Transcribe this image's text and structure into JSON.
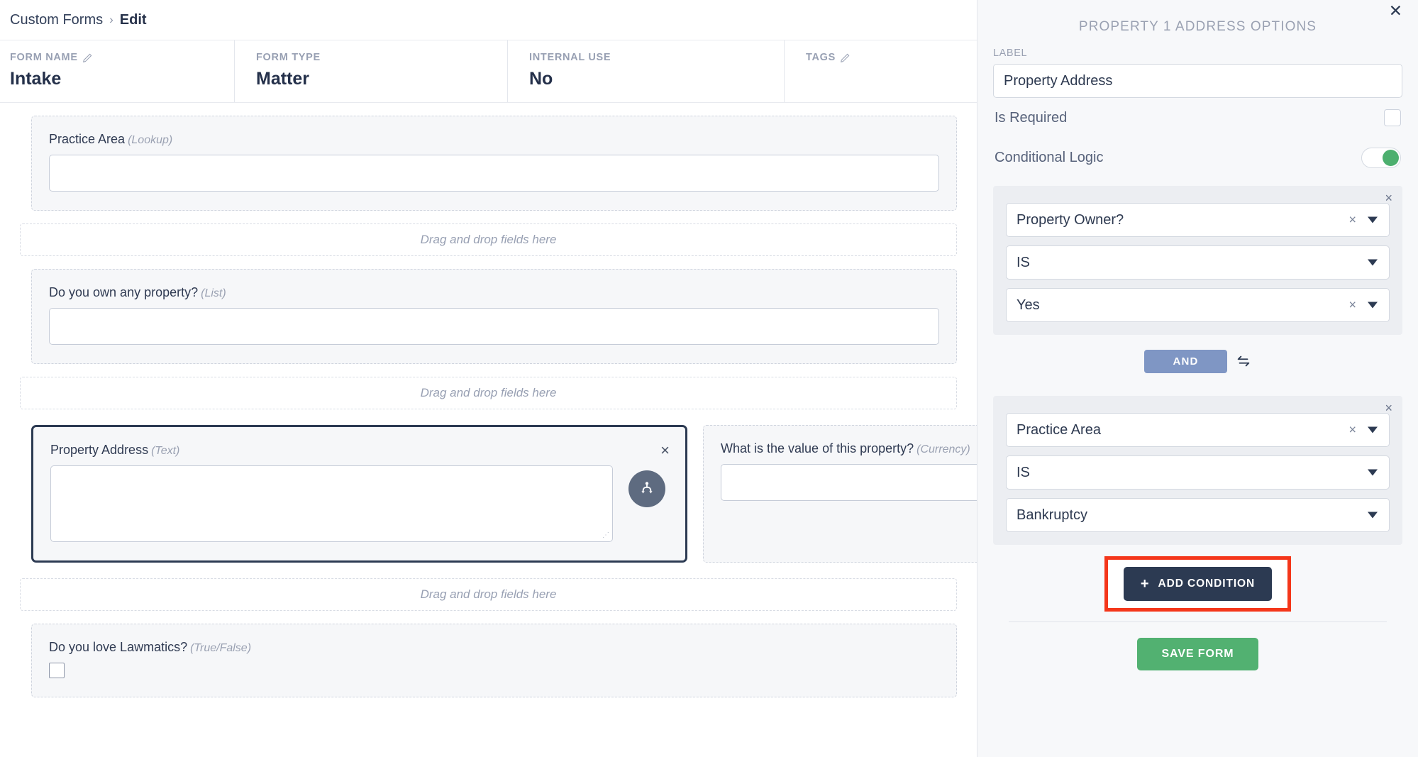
{
  "breadcrumb": {
    "root": "Custom Forms",
    "separator": "›",
    "current": "Edit"
  },
  "meta": [
    {
      "label": "FORM NAME",
      "value": "Intake",
      "has_edit_icon": true,
      "edit_icon": "pencil-icon"
    },
    {
      "label": "FORM TYPE",
      "value": "Matter",
      "has_edit_icon": false
    },
    {
      "label": "INTERNAL USE",
      "value": "No",
      "has_edit_icon": false
    },
    {
      "label": "TAGS",
      "value": "",
      "has_edit_icon": true,
      "edit_icon": "pencil-icon"
    }
  ],
  "canvas": {
    "dropzone_text": "Drag and drop fields here",
    "fields": [
      {
        "label": "Practice Area",
        "type": "(Lookup)",
        "control": "input"
      },
      {
        "label": "Do you own any property?",
        "type": "(List)",
        "control": "input"
      },
      {
        "label": "Property Address",
        "type": "(Text)",
        "control": "textarea",
        "selected": true,
        "remove_label": "×",
        "badge_icon": "conditional-logic-branch-icon"
      },
      {
        "label": "What is the value of this property?",
        "type": "(Currency)",
        "control": "input"
      },
      {
        "label": "Do you love Lawmatics?",
        "type": "(True/False)",
        "control": "checkbox"
      }
    ]
  },
  "panel": {
    "title": "PROPERTY 1 ADDRESS OPTIONS",
    "close_label": "✕",
    "label_caption": "LABEL",
    "label_value": "Property Address",
    "label_placeholder": "Label",
    "options": [
      {
        "name": "Is Required",
        "control": "checkbox",
        "checked": false
      },
      {
        "name": "Conditional Logic",
        "control": "toggle",
        "checked": true
      }
    ],
    "condition_groups": [
      {
        "close_label": "×",
        "field": {
          "value": "Property Owner?",
          "clearable": true,
          "clear_label": "×"
        },
        "operator": {
          "value": "IS",
          "clearable": false
        },
        "comparison": {
          "value": "Yes",
          "clearable": true,
          "clear_label": "×"
        }
      },
      {
        "close_label": "×",
        "field": {
          "value": "Practice Area",
          "clearable": true,
          "clear_label": "×"
        },
        "operator": {
          "value": "IS",
          "clearable": false
        },
        "comparison": {
          "value": "Bankruptcy",
          "clearable": false
        }
      }
    ],
    "conjunction": {
      "label": "AND",
      "swap_icon": "swap-arrows-icon"
    },
    "add_condition": {
      "label": "ADD CONDITION",
      "plus": "+",
      "highlighted": true,
      "highlight_color": "#f4361a"
    },
    "save": {
      "label": "SAVE FORM",
      "color": "#52b171"
    }
  },
  "colors": {
    "panel_bg": "#f7f8fa",
    "group_bg": "#eceef2",
    "dark_navy": "#2c3a52",
    "and_chip": "#7f96c4",
    "toggle_on": "#4caf6e",
    "badge_gray": "#5e6b80"
  }
}
